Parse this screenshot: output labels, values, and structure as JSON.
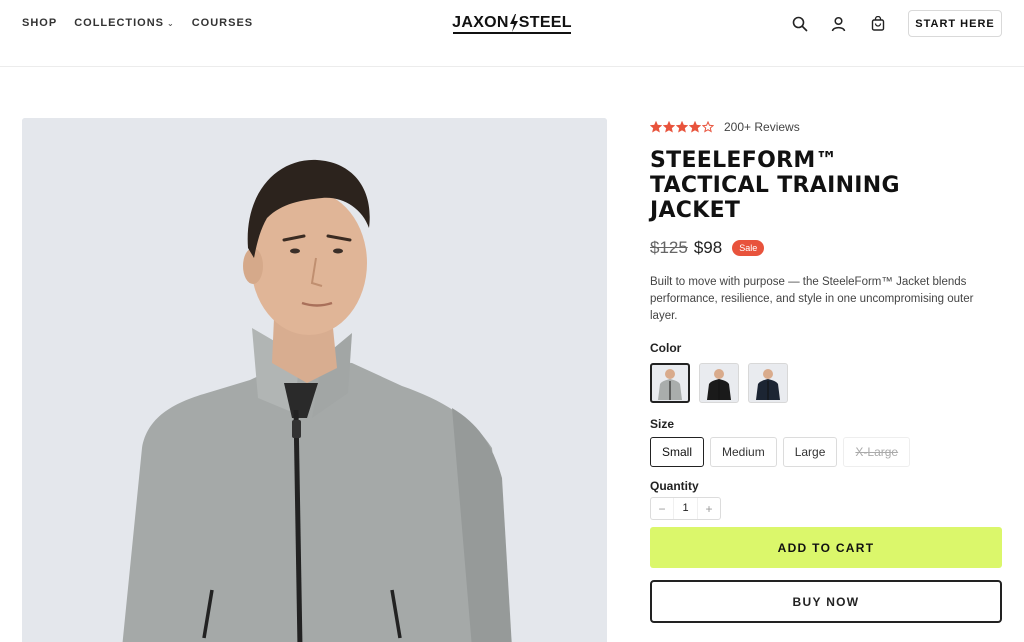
{
  "header": {
    "nav": [
      {
        "label": "SHOP"
      },
      {
        "label": "COLLECTIONS"
      },
      {
        "label": "COURSES"
      }
    ],
    "logo_left": "JAXON",
    "logo_right": "STEEL",
    "icons": [
      "search-icon",
      "user-icon",
      "cart-icon"
    ],
    "cta_label": "START HERE"
  },
  "product": {
    "rating": 4,
    "rating_max": 5,
    "reviews_label": "200+ Reviews",
    "title": "STEELEFORM™ TACTICAL TRAINING JACKET",
    "old_price": "$125",
    "price": "$98",
    "badge": "Sale",
    "description": "Built to move with purpose — the SteeleForm™ Jacket blends performance, resilience, and style in one uncompromising outer layer.",
    "color_label": "Color",
    "colors": [
      {
        "name": "gray",
        "hex": "#a9adac",
        "selected": true
      },
      {
        "name": "black",
        "hex": "#1a1a1a",
        "selected": false
      },
      {
        "name": "navy",
        "hex": "#1c2533",
        "selected": false
      }
    ],
    "size_label": "Size",
    "sizes": [
      {
        "label": "Small",
        "selected": true,
        "available": true
      },
      {
        "label": "Medium",
        "selected": false,
        "available": true
      },
      {
        "label": "Large",
        "selected": false,
        "available": true
      },
      {
        "label": "X-Large",
        "selected": false,
        "available": false
      }
    ],
    "quantity_label": "Quantity",
    "quantity": "1",
    "qty_minus": "−",
    "qty_plus": "+",
    "add_to_cart": "ADD TO CART",
    "buy_now": "BUY NOW"
  },
  "colors": {
    "accent": "#dbf76b",
    "star": "#e8533c",
    "sale": "#e8533c",
    "image_bg": "#e4e7ec"
  }
}
